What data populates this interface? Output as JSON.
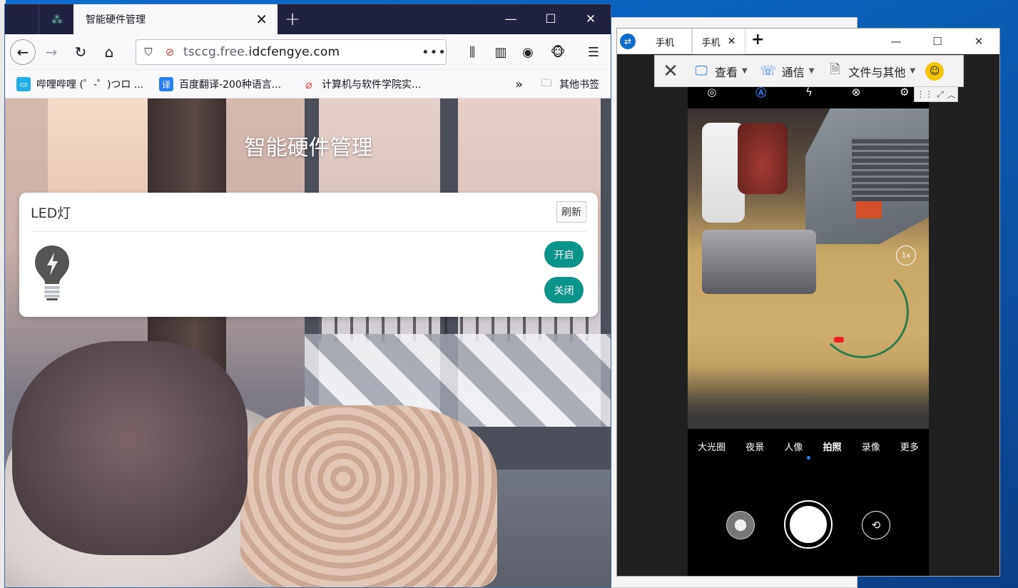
{
  "firefox": {
    "tab_title": "智能硬件管理",
    "url_host_prefix": "tsccg.free.",
    "url_host_main": "idcfengye.com",
    "bookmarks": [
      {
        "label": "哔哩哔哩 (゜-゜)つロ ...",
        "color": "#23ade5"
      },
      {
        "label": "百度翻译-200种语言...",
        "color": "#2a7ff0",
        "glyph": "译"
      },
      {
        "label": "计算机与软件学院实...",
        "color": "#e0493d"
      }
    ],
    "bookmarks_more": "»",
    "other_bookmarks": "其他书签"
  },
  "page": {
    "title": "智能硬件管理",
    "card_title": "LED灯",
    "refresh_label": "刷新",
    "on_label": "开启",
    "off_label": "关闭",
    "button_color": "#0d9488"
  },
  "teamviewer": {
    "tabs": [
      {
        "label": "手机"
      },
      {
        "label": "手机"
      }
    ],
    "toolbar": {
      "view_label": "查看",
      "comm_label": "通信",
      "files_label": "文件与其他"
    }
  },
  "phone": {
    "zoom": "1x",
    "modes": [
      "大光圈",
      "夜景",
      "人像",
      "拍照",
      "录像",
      "更多"
    ],
    "active_mode": "拍照",
    "accent": "#2f7df6"
  }
}
